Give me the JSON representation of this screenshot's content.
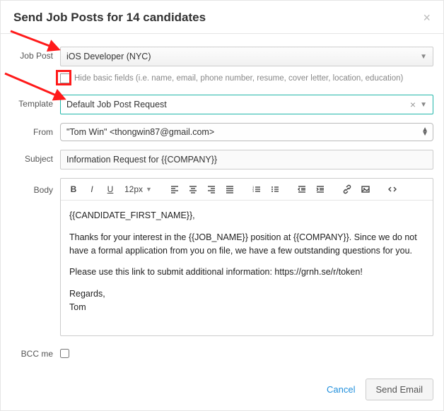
{
  "header": {
    "title": "Send Job Posts for 14 candidates"
  },
  "labels": {
    "jobPost": "Job Post",
    "template": "Template",
    "from": "From",
    "subject": "Subject",
    "body": "Body",
    "bccMe": "BCC me"
  },
  "fields": {
    "jobPost": "iOS Developer (NYC)",
    "hideBasic": "Hide basic fields (i.e. name, email, phone number, resume, cover letter, location, education)",
    "template": "Default Job Post Request",
    "from": "\"Tom Win\" <thongwin87@gmail.com>",
    "subject": "Information Request for {{COMPANY}}",
    "fontSize": "12px"
  },
  "body": {
    "line1": "{{CANDIDATE_FIRST_NAME}},",
    "line2": "Thanks for your interest in the {{JOB_NAME}} position at {{COMPANY}}. Since we do not have a formal application from you on file, we have a few outstanding questions for you.",
    "line3": "Please use this link to submit additional information: https://grnh.se/r/token!",
    "line4": "Regards,",
    "line5": "Tom"
  },
  "footer": {
    "cancel": "Cancel",
    "send": "Send Email"
  },
  "colors": {
    "teal": "#1fb6a9",
    "red": "#ff1a1a",
    "link": "#1f8fdc"
  }
}
